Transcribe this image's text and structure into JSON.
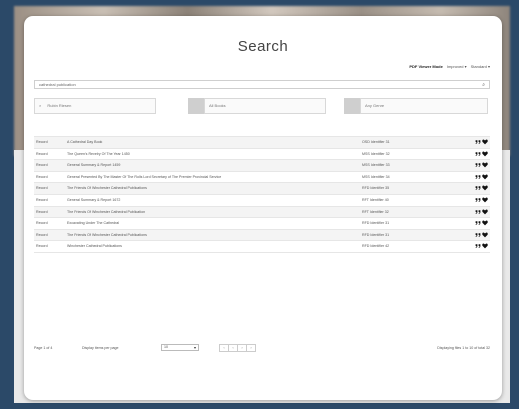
{
  "page": {
    "title": "Search"
  },
  "sort": {
    "options": [
      "PDF Viewer Mode",
      "Improved ▾",
      "Standard ▾"
    ],
    "active_index": 0
  },
  "search": {
    "value": "cathedral publication",
    "icon": "search-icon"
  },
  "filters": [
    {
      "label": "Rubin Riesen"
    },
    {
      "label": "All Books"
    },
    {
      "label": "Any Genre"
    }
  ],
  "results": {
    "rows": [
      {
        "type": "Record",
        "title": "A Cathedral Day Book",
        "id": "OSD Identifier 31"
      },
      {
        "type": "Record",
        "title": "The Queen's Revelry Of The Year 1450",
        "id": "MSS Identifier 32"
      },
      {
        "type": "Record",
        "title": "General Summary & Report 1459",
        "id": "MSS Identifier 33"
      },
      {
        "type": "Record",
        "title": "General Presented By The Master Of The Rolls Lord Secretary of The Premier Provincial Service",
        "id": "MSS Identifier 34"
      },
      {
        "type": "Record",
        "title": "The Friends Of Winchester Cathedral Publications",
        "id": "RFD Identifier 35"
      },
      {
        "type": "Record",
        "title": "General Summary & Report 1672",
        "id": "RFT Identifier 40"
      },
      {
        "type": "Record",
        "title": "The Friends Of Winchester Cathedral Publication",
        "id": "RFT Identifier 32"
      },
      {
        "type": "Record",
        "title": "Excavating Under The Cathedral",
        "id": "RFD Identifier 31"
      },
      {
        "type": "Record",
        "title": "The Friends Of Winchester Cathedral Publications",
        "id": "RFD Identifier 31"
      },
      {
        "type": "Record",
        "title": "Winchester Cathedral Publications",
        "id": "RFD Identifier 42"
      }
    ],
    "action_icons": [
      "quote-icon",
      "heart-icon"
    ]
  },
  "footer": {
    "page_label": "Page 1 of 4",
    "items_per_page_label": "Display items per page",
    "items_per_page_value": "10",
    "pager": [
      "‹",
      "‹",
      "›",
      "›"
    ],
    "display_text": "Displaying files 1 to 10 of total 32"
  }
}
